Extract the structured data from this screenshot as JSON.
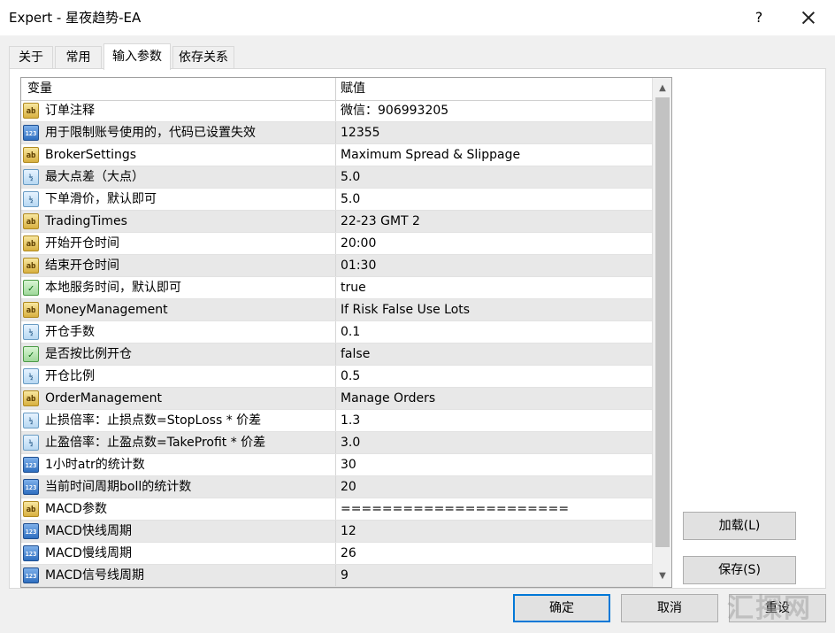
{
  "window": {
    "title": "Expert - 星夜趋势-EA",
    "help_label": "?"
  },
  "tabs": [
    {
      "label": "关于"
    },
    {
      "label": "常用"
    },
    {
      "label": "输入参数"
    },
    {
      "label": "依存关系"
    }
  ],
  "grid": {
    "headers": {
      "variable": "变量",
      "value": "赋值"
    },
    "rows": [
      {
        "type": "ab",
        "name": "订单注释",
        "value": "微信：906993205"
      },
      {
        "type": "123",
        "name": "用于限制账号使用的，代码已设置失效",
        "value": "12355"
      },
      {
        "type": "ab",
        "name": "BrokerSettings",
        "value": "Maximum Spread & Slippage"
      },
      {
        "type": "half",
        "name": "最大点差（大点）",
        "value": "5.0"
      },
      {
        "type": "half",
        "name": "下单滑价，默认即可",
        "value": "5.0"
      },
      {
        "type": "ab",
        "name": "TradingTimes",
        "value": "22-23 GMT 2"
      },
      {
        "type": "ab",
        "name": "开始开仓时间",
        "value": "20:00"
      },
      {
        "type": "ab",
        "name": "结束开仓时间",
        "value": "01:30"
      },
      {
        "type": "bool",
        "name": "本地服务时间，默认即可",
        "value": "true"
      },
      {
        "type": "ab",
        "name": "MoneyManagement",
        "value": "If Risk False Use Lots"
      },
      {
        "type": "half",
        "name": "开仓手数",
        "value": "0.1"
      },
      {
        "type": "bool",
        "name": "是否按比例开仓",
        "value": "false"
      },
      {
        "type": "half",
        "name": "开仓比例",
        "value": "0.5"
      },
      {
        "type": "ab",
        "name": "OrderManagement",
        "value": "Manage Orders"
      },
      {
        "type": "half",
        "name": "止损倍率：止损点数=StopLoss * 价差",
        "value": "1.3"
      },
      {
        "type": "half",
        "name": "止盈倍率：止盈点数=TakeProfit * 价差",
        "value": "3.0"
      },
      {
        "type": "123",
        "name": "1小时atr的统计数",
        "value": "30"
      },
      {
        "type": "123",
        "name": "当前时间周期boll的统计数",
        "value": "20"
      },
      {
        "type": "ab",
        "name": "MACD参数",
        "value": "======================"
      },
      {
        "type": "123",
        "name": "MACD快线周期",
        "value": "12"
      },
      {
        "type": "123",
        "name": "MACD慢线周期",
        "value": "26"
      },
      {
        "type": "123",
        "name": "MACD信号线周期",
        "value": "9"
      }
    ]
  },
  "icons": {
    "ab": "ab",
    "123": "123",
    "half": "½",
    "bool": "✓"
  },
  "buttons": {
    "load": "加载(L)",
    "save": "保存(S)",
    "ok": "确定",
    "cancel": "取消",
    "reset": "重设"
  },
  "watermark": "汇探网"
}
